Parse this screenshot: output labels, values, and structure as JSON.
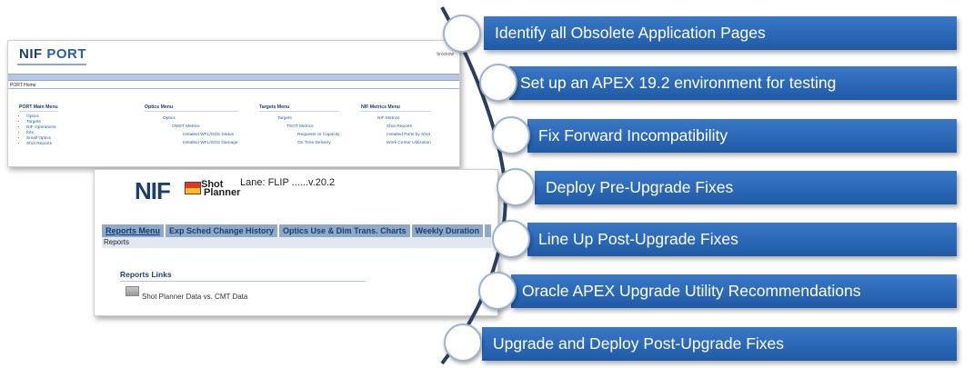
{
  "port": {
    "logo_main": "NIF",
    "logo_sub": "PORT",
    "user": "brockow",
    "breadcrumb": "PORT Home",
    "menus": [
      {
        "header": "PORT Main Menu",
        "items": [
          "Optics",
          "Targets",
          "NIF Operations",
          "Kits",
          "Small Optics",
          "Shot Reports"
        ]
      },
      {
        "header": "Optics Menu",
        "items": [
          "Optics",
          "OMST Metrics",
          "Installed WFL/GDS Status",
          "Installed WFL/GDS Damage"
        ]
      },
      {
        "header": "Targets Menu",
        "items": [
          "Targets",
          "TSOT Metrics",
          "Requests vs Capacity",
          "On Time Delivery"
        ]
      },
      {
        "header": "NIF Metrics Menu",
        "items": [
          "NIF Metrics",
          "Shot Reports",
          "Installed Parts by Shot",
          "Work Center Utilization"
        ]
      }
    ]
  },
  "shot": {
    "logo_main": "NIF",
    "brand_line1": "Shot",
    "brand_line2": "Planner",
    "lane": "Lane: FLIP ......v.20.2",
    "tabs": [
      "Reports Menu",
      "Exp Sched Change History",
      "Optics Use & Dim Trans. Charts",
      "Weekly Duration"
    ],
    "breadcrumb": "Reports",
    "links_header": "Reports Links",
    "link": "Shot Planner Data vs. CMT Data"
  },
  "steps": [
    "Identify all Obsolete Application Pages",
    "Set up an APEX 19.2 environment for testing",
    "Fix Forward Incompatibility",
    "Deploy Pre-Upgrade Fixes",
    "Line Up Post-Upgrade Fixes",
    "Oracle APEX Upgrade Utility Recommendations",
    "Upgrade and Deploy Post-Upgrade Fixes"
  ],
  "colors": {
    "step_bg": "#2866b4",
    "spine": "#2a3f5f",
    "brand_navy": "#1d3f6e"
  }
}
